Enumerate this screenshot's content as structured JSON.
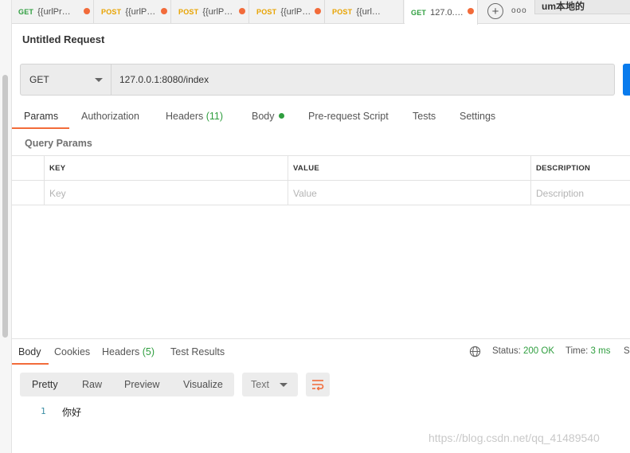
{
  "tabs": [
    {
      "method": "GET",
      "name": "{{urlPr…"
    },
    {
      "method": "POST",
      "name": "{{urlP…"
    },
    {
      "method": "POST",
      "name": "{{urlP…"
    },
    {
      "method": "POST",
      "name": "{{urlP…"
    },
    {
      "method": "POST",
      "name": "{{url…"
    },
    {
      "method": "GET",
      "name": "127.0.…"
    }
  ],
  "tab_add_label": "+",
  "tab_more_label": "ooo",
  "environment": "um本地的",
  "request": {
    "title": "Untitled Request",
    "method": "GET",
    "url": "127.0.0.1:8080/index"
  },
  "request_tabs": {
    "params": "Params",
    "authorization": "Authorization",
    "headers": "Headers",
    "headers_count": "(11)",
    "body": "Body",
    "prerequest": "Pre-request Script",
    "tests": "Tests",
    "settings": "Settings"
  },
  "query_params": {
    "title": "Query Params",
    "columns": [
      "KEY",
      "VALUE",
      "DESCRIPTION"
    ],
    "placeholders": [
      "Key",
      "Value",
      "Description"
    ]
  },
  "response": {
    "tabs": {
      "body": "Body",
      "cookies": "Cookies",
      "headers": "Headers",
      "headers_count": "(5)",
      "test_results": "Test Results"
    },
    "status_label": "Status:",
    "status_value": "200 OK",
    "time_label": "Time:",
    "time_value": "3 ms",
    "size_label": "Si",
    "formats": [
      "Pretty",
      "Raw",
      "Preview",
      "Visualize"
    ],
    "text_type": "Text",
    "line_number": "1",
    "line_text": "你好"
  },
  "watermark": "https://blog.csdn.net/qq_41489540",
  "colors": {
    "accent": "#f26b3a",
    "get": "#2f9e3f",
    "post": "#e8a300",
    "send": "#097bed"
  }
}
